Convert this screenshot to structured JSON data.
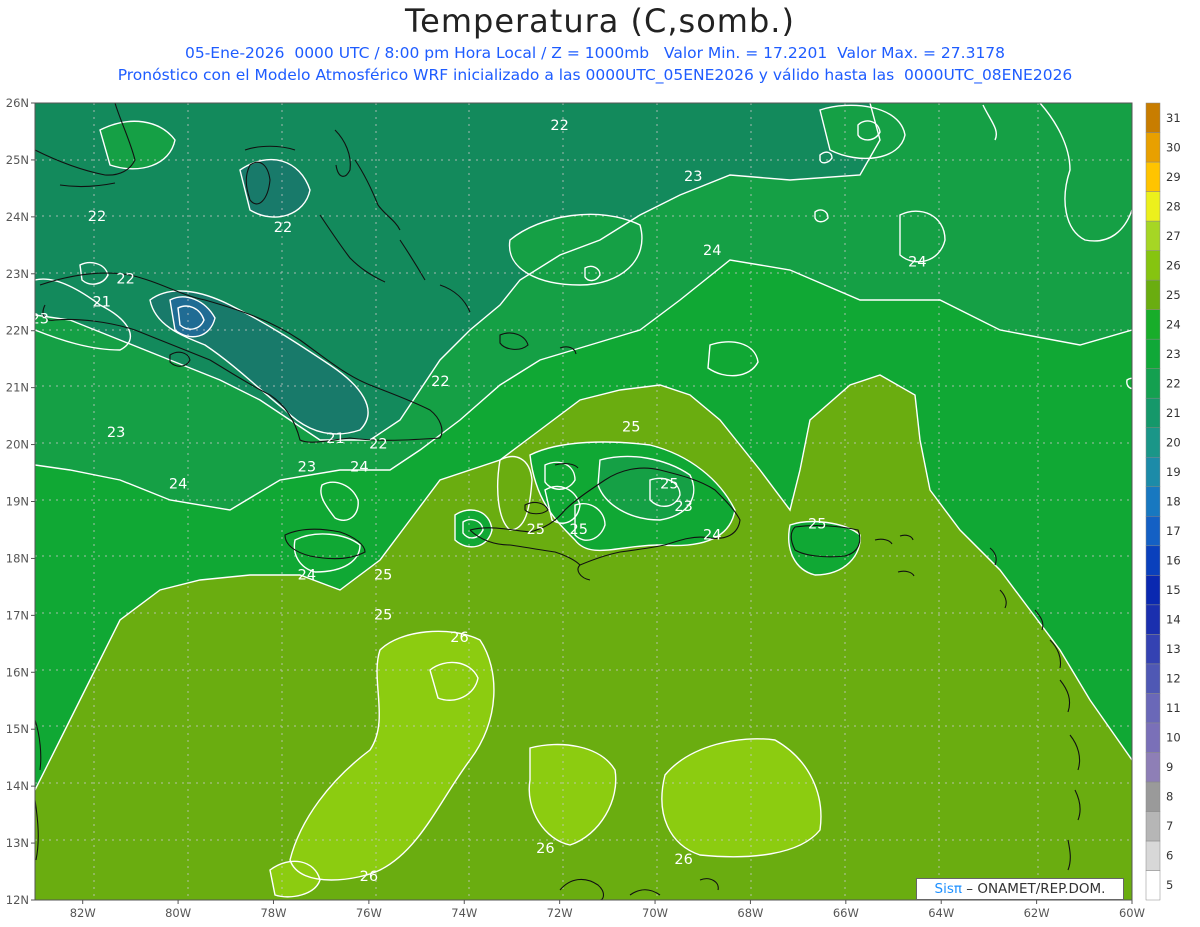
{
  "title": "Temperatura (C,somb.)",
  "subtitle_line1": "05-Ene-2026  0000 UTC / 8:00 pm Hora Local / Z = 1000mb   Valor Min. = 17.2201  Valor Max. = 27.3178",
  "subtitle_line2": "Pronóstico con el Modelo Atmosférico WRF inicializado a las 0000UTC_05ENE2026 y válido hasta las  0000UTC_08ENE2026",
  "credit": {
    "brand": "Sisπ",
    "text": " – ONAMET/REP.DOM."
  },
  "map": {
    "lon_range": [
      -83,
      -60
    ],
    "lat_range": [
      12,
      26
    ],
    "grid": "dotted",
    "lon_ticks": [
      "82W",
      "80W",
      "78W",
      "76W",
      "74W",
      "72W",
      "70W",
      "68W",
      "66W",
      "64W",
      "62W",
      "60W"
    ],
    "lat_ticks": [
      "12N",
      "13N",
      "14N",
      "15N",
      "16N",
      "17N",
      "18N",
      "19N",
      "20N",
      "21N",
      "22N",
      "23N",
      "24N",
      "25N",
      "26N"
    ],
    "contour_labels": [
      {
        "text": "22",
        "lon": -72.0,
        "lat": 25.6
      },
      {
        "text": "23",
        "lon": -69.2,
        "lat": 24.7
      },
      {
        "text": "22",
        "lon": -81.7,
        "lat": 24.0
      },
      {
        "text": "22",
        "lon": -77.8,
        "lat": 23.8
      },
      {
        "text": "24",
        "lon": -68.8,
        "lat": 23.4
      },
      {
        "text": "24",
        "lon": -64.5,
        "lat": 23.2
      },
      {
        "text": "22",
        "lon": -81.1,
        "lat": 22.9
      },
      {
        "text": "21",
        "lon": -81.6,
        "lat": 22.5
      },
      {
        "text": "23",
        "lon": -82.9,
        "lat": 22.2
      },
      {
        "text": "22",
        "lon": -74.5,
        "lat": 21.1
      },
      {
        "text": "23",
        "lon": -81.3,
        "lat": 20.2
      },
      {
        "text": "21",
        "lon": -76.7,
        "lat": 20.1
      },
      {
        "text": "22",
        "lon": -75.8,
        "lat": 20.0
      },
      {
        "text": "25",
        "lon": -70.5,
        "lat": 20.3
      },
      {
        "text": "23",
        "lon": -77.3,
        "lat": 19.6
      },
      {
        "text": "24",
        "lon": -76.2,
        "lat": 19.6
      },
      {
        "text": "24",
        "lon": -80.0,
        "lat": 19.3
      },
      {
        "text": "25",
        "lon": -69.7,
        "lat": 19.3
      },
      {
        "text": "23",
        "lon": -69.4,
        "lat": 18.9
      },
      {
        "text": "25",
        "lon": -72.5,
        "lat": 18.5
      },
      {
        "text": "25",
        "lon": -71.6,
        "lat": 18.5
      },
      {
        "text": "25",
        "lon": -66.6,
        "lat": 18.6
      },
      {
        "text": "24",
        "lon": -68.8,
        "lat": 18.4
      },
      {
        "text": "24",
        "lon": -77.3,
        "lat": 17.7
      },
      {
        "text": "25",
        "lon": -75.7,
        "lat": 17.7
      },
      {
        "text": "25",
        "lon": -75.7,
        "lat": 17.0
      },
      {
        "text": "26",
        "lon": -74.1,
        "lat": 16.6
      },
      {
        "text": "26",
        "lon": -72.3,
        "lat": 12.9
      },
      {
        "text": "26",
        "lon": -69.4,
        "lat": 12.7
      },
      {
        "text": "26",
        "lon": -76.0,
        "lat": 12.4
      }
    ]
  },
  "colorbar": {
    "levels": [
      "5",
      "6",
      "7",
      "8",
      "9",
      "10",
      "11",
      "12",
      "13",
      "14",
      "15",
      "16",
      "17",
      "18",
      "19",
      "20",
      "21",
      "22",
      "23",
      "24",
      "25",
      "26",
      "27",
      "28",
      "29",
      "30",
      "31"
    ],
    "colors": [
      "#ffffff",
      "#d8d8d8",
      "#b6b6b6",
      "#9a9a9a",
      "#8e7fb6",
      "#7a70b8",
      "#6a68b8",
      "#4f58b4",
      "#3442b2",
      "#1a2fae",
      "#0a28b0",
      "#0a40bc",
      "#1460c4",
      "#1878c0",
      "#1c8ba8",
      "#1a9688",
      "#15986a",
      "#14a050",
      "#10a838",
      "#18ad2a",
      "#6aad10",
      "#86c410",
      "#a6d624",
      "#ecf01c",
      "#ffc400",
      "#e8a000",
      "#c87d00"
    ]
  },
  "colors": {
    "t21": "#187a6a",
    "t22": "#138a5c",
    "t23": "#15a045",
    "t24": "#10a834",
    "t25": "#6aad10",
    "t26": "#8ccc10",
    "t20": "#1e6e82",
    "t19": "#206c94"
  }
}
